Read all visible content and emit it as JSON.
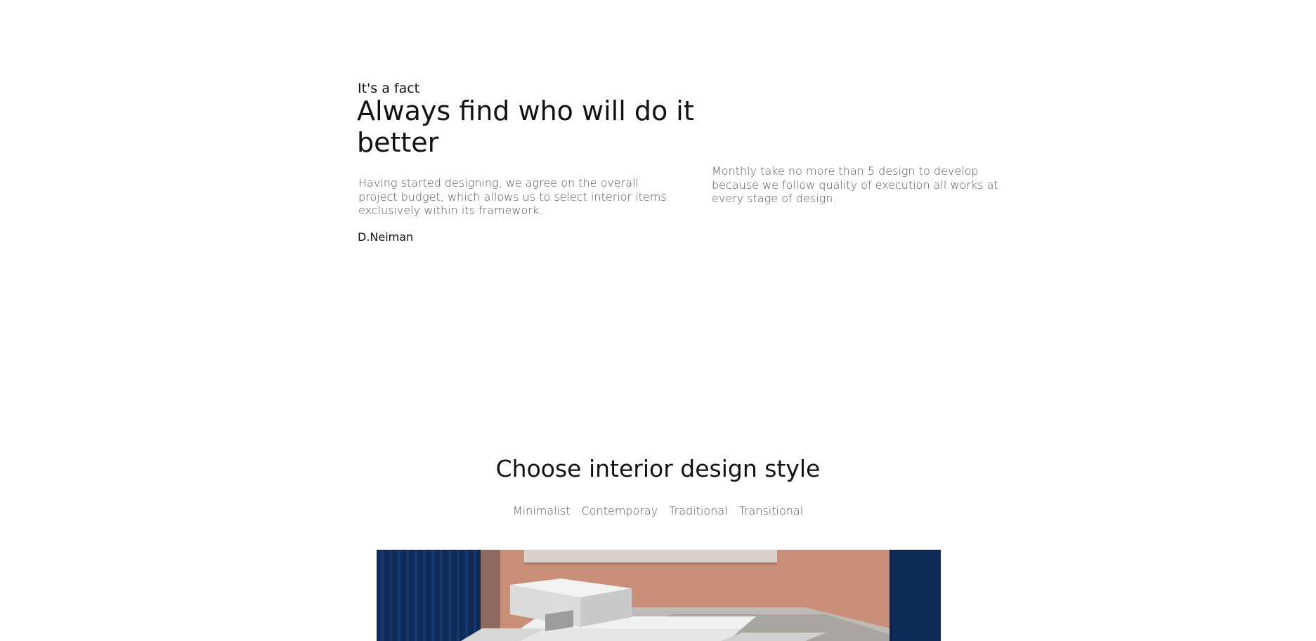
{
  "fact": {
    "eyebrow": "It's a fact",
    "headline": "Always find who will do it better",
    "left_body": "Having started designing, we agree on the overall project budget, which allows us to select interior items exclusively within its framework.",
    "author": "D.Neiman",
    "right_body": "Monthly take no more than 5 design to develop because we follow quality of execution all works at every stage of design."
  },
  "styles": {
    "title": "Choose interior design style",
    "tabs": [
      {
        "label": "Minimalist"
      },
      {
        "label": "Contemporay"
      },
      {
        "label": "Traditional"
      },
      {
        "label": "Transitional"
      }
    ]
  },
  "colors": {
    "accent_navy": "#0f2a57",
    "accent_terracotta": "#c98f78",
    "text_muted": "#555555",
    "text_dark": "#111111"
  }
}
